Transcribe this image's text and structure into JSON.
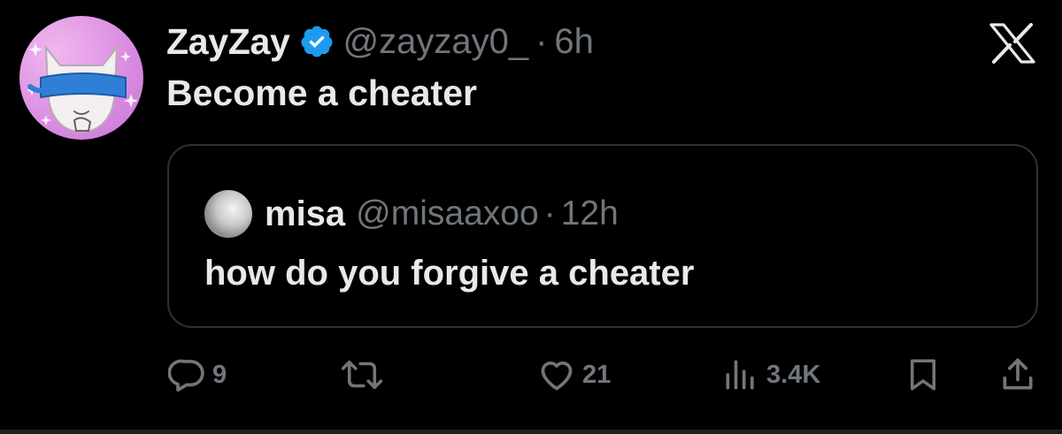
{
  "tweet": {
    "display_name": "ZayZay",
    "handle": "@zayzay0_",
    "separator": "·",
    "time": "6h",
    "text": "Become a cheater",
    "avatar_icon": "cat-blindfold-avatar",
    "verified_icon": "verified-badge-icon",
    "verified_color": "#1d9bf0",
    "brand_icon": "x-logo-icon"
  },
  "quote": {
    "display_name": "misa",
    "handle": "@misaaxoo",
    "separator": "·",
    "time": "12h",
    "text": "how do you forgive a cheater",
    "avatar_icon": "moon-avatar"
  },
  "actions": {
    "reply_count": "9",
    "like_count": "21",
    "views_count": "3.4K"
  },
  "colors": {
    "background": "#000000",
    "primary_text": "#e7e9ea",
    "secondary_text": "#71767b",
    "border": "#2f3336"
  }
}
